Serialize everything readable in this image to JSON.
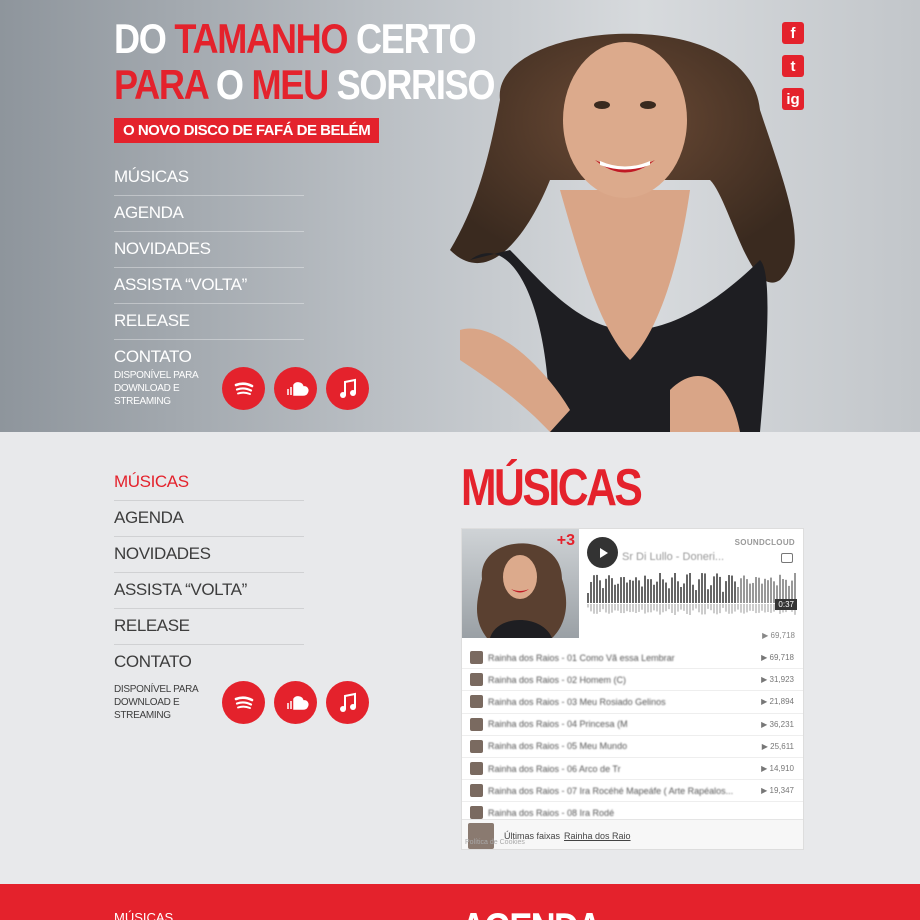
{
  "hero": {
    "title_line1": {
      "a": "DO ",
      "b": "TAMANHO",
      "c": " CERTO"
    },
    "title_line2": {
      "a": "PARA",
      "b": " O ",
      "c": "MEU",
      "d": " SORRISO"
    },
    "badge": "O NOVO DISCO DE FAFÁ DE BELÉM",
    "nav": [
      "MÚSICAS",
      "AGENDA",
      "NOVIDADES",
      "ASSISTA “VOLTA”",
      "RELEASE",
      "CONTATO"
    ],
    "stream_label_1": "DISPONÍVEL PARA",
    "stream_label_2": "DOWNLOAD E STREAMING"
  },
  "social": {
    "facebook": "f",
    "twitter": "t",
    "instagram": "ig"
  },
  "musicas": {
    "heading": "MÚSICAS",
    "nav": [
      "MÚSICAS",
      "AGENDA",
      "NOVIDADES",
      "ASSISTA “VOLTA”",
      "RELEASE",
      "CONTATO"
    ],
    "active": "MÚSICAS",
    "stream_label_1": "DISPONÍVEL PARA",
    "stream_label_2": "DOWNLOAD E STREAMING"
  },
  "soundcloud": {
    "brand": "SOUNDCLOUD",
    "track_title": "Sr Di Lullo - Doneri...",
    "time": "0:37",
    "plays": "▶ 69,718",
    "tracks": [
      {
        "name": "Rainha dos Raios - 01 Como Vã essa Lembrar",
        "count": "▶ 69,718"
      },
      {
        "name": "Rainha dos Raios - 02 Homem (C)",
        "count": "▶ 31,923"
      },
      {
        "name": "Rainha dos Raios - 03 Meu Rosiado Gelinos",
        "count": "▶ 21,894"
      },
      {
        "name": "Rainha dos Raios - 04 Princesa (M",
        "count": "▶ 36,231"
      },
      {
        "name": "Rainha dos Raios - 05 Meu Mundo",
        "count": "▶ 25,611"
      },
      {
        "name": "Rainha dos Raios - 06 Arco de Tr",
        "count": "▶ 14,910"
      },
      {
        "name": "Rainha dos Raios - 07 Ira Rocéhé Mapeáfe ( Arte Rapéalos...",
        "count": "▶ 19,347"
      },
      {
        "name": "Rainha dos Raios - 08 Ira Rodé",
        "count": ""
      }
    ],
    "footer_text": "Últimas faixas",
    "footer_link": "Rainha dos Raio",
    "cookies": "Política de Cookies"
  },
  "next_section": {
    "nav_first": "MÚSICAS",
    "heading": "AGENDA"
  },
  "colors": {
    "accent": "#e4222c",
    "text_dark": "#3d3d3d",
    "bg": "#e8e9eb"
  }
}
